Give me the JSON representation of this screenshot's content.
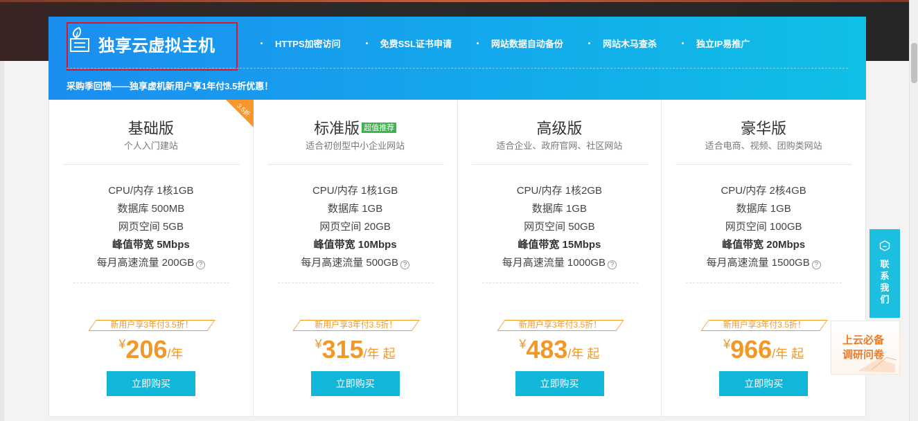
{
  "banner": {
    "title": "独享云虚拟主机",
    "features": [
      "HTTPS加密访问",
      "免费SSL证书申请",
      "网站数据自动备份",
      "网站木马查杀",
      "独立IP易推广"
    ],
    "promo": "采购季回馈——独享虚机新用户享1年付3.5折优惠！"
  },
  "plans": [
    {
      "name": "基础版",
      "badge": "",
      "ribbon": "3.5折",
      "desc": "个人入门建站",
      "specs": [
        "CPU/内存 1核1GB",
        "数据库 500MB",
        "网页空间 5GB",
        "峰值带宽 5Mbps",
        "每月高速流量 200GB"
      ],
      "offer": "新用户享3年付3.5折！",
      "yen": "¥",
      "price": "206",
      "unit": "/年",
      "button": "立即购买"
    },
    {
      "name": "标准版",
      "badge": "超值推荐",
      "ribbon": "",
      "desc": "适合初创型中小企业网站",
      "specs": [
        "CPU/内存 1核1GB",
        "数据库 1GB",
        "网页空间 20GB",
        "峰值带宽 10Mbps",
        "每月高速流量 500GB"
      ],
      "offer": "新用户享3年付3.5折！",
      "yen": "¥",
      "price": "315",
      "unit": "/年 起",
      "button": "立即购买"
    },
    {
      "name": "高级版",
      "badge": "",
      "ribbon": "",
      "desc": "适合企业、政府官网、社区网站",
      "specs": [
        "CPU/内存 1核2GB",
        "数据库 1GB",
        "网页空间 50GB",
        "峰值带宽 15Mbps",
        "每月高速流量 1000GB"
      ],
      "offer": "新用户享3年付3.5折！",
      "yen": "¥",
      "price": "483",
      "unit": "/年 起",
      "button": "立即购买"
    },
    {
      "name": "豪华版",
      "badge": "",
      "ribbon": "",
      "desc": "适合电商、视频、团购类网站",
      "specs": [
        "CPU/内存 2核4GB",
        "数据库 1GB",
        "网页空间 100GB",
        "峰值带宽 20Mbps",
        "每月高速流量 1500GB"
      ],
      "offer": "新用户享3年付3.5折！",
      "yen": "¥",
      "price": "966",
      "unit": "/年 起",
      "button": "立即购买"
    }
  ],
  "help_glyph": "?",
  "contact": {
    "chars": [
      "联",
      "系",
      "我",
      "们"
    ],
    "icon": "chat-bubble-icon"
  },
  "survey": {
    "line1": "上云必备",
    "line2": "调研问卷"
  },
  "colors": {
    "banner_start": "#1b8ef0",
    "banner_end": "#0fc0e6",
    "accent_orange": "#f39826",
    "button": "#12b6d8",
    "badge_green": "#3cb54a",
    "highlight_red": "#e0132b"
  }
}
